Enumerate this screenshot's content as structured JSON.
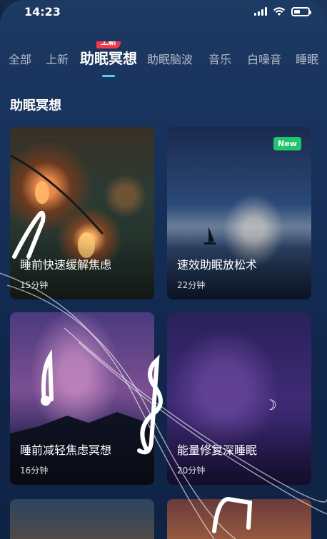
{
  "status_bar": {
    "time": "14:23"
  },
  "tabs": [
    {
      "label": "全部"
    },
    {
      "label": "上新"
    },
    {
      "label": "助眠冥想",
      "badge": "上新",
      "active": true
    },
    {
      "label": "助眠脑波"
    },
    {
      "label": "音乐"
    },
    {
      "label": "白噪音"
    },
    {
      "label": "睡眠"
    }
  ],
  "section": {
    "title": "助眠冥想"
  },
  "cards": [
    {
      "title": "睡前快速缓解焦虑",
      "duration": "15分钟"
    },
    {
      "title": "速效助眠放松术",
      "duration": "22分钟",
      "badge": "New"
    },
    {
      "title": "睡前减轻焦虑冥想",
      "duration": "16分钟"
    },
    {
      "title": "能量修复深睡眠",
      "duration": "20分钟"
    }
  ],
  "colors": {
    "accent": "#4ad3e6",
    "badge_red": "#ef3b49",
    "badge_green": "#23c470"
  },
  "icons": [
    "signal-icon",
    "wifi-icon",
    "battery-icon",
    "music-note-icon",
    "treble-clef-icon",
    "moon-icon"
  ]
}
